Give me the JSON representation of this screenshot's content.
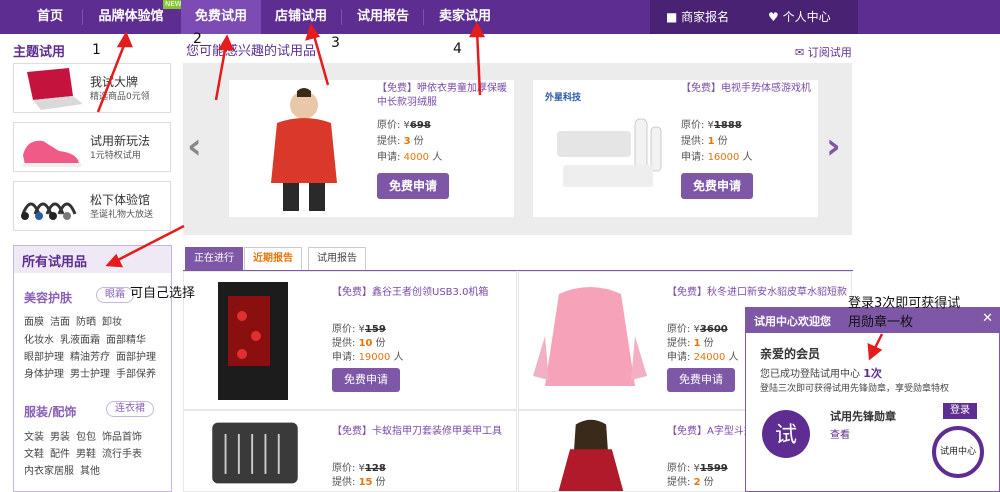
{
  "nav": {
    "items": [
      "首页",
      "品牌体验馆",
      "免费试用",
      "店铺试用",
      "试用报告",
      "卖家试用"
    ],
    "new_badge": "NEW",
    "merchant": "商家报名",
    "personal": "个人中心"
  },
  "sidebar": {
    "theme_title": "主题试用",
    "promos": [
      {
        "line1": "我试大牌",
        "line2": "精选商品0元领"
      },
      {
        "line1": "试用新玩法",
        "line2": "1元特权试用"
      },
      {
        "line1": "松下体验馆",
        "line2": "圣诞礼物大放送"
      }
    ],
    "all_title": "所有试用品",
    "groups": [
      {
        "title": "美容护肤",
        "tag": "眼霜",
        "rows": [
          [
            "面膜",
            "洁面",
            "防晒",
            "卸妆"
          ],
          [
            "化妆水",
            "乳液面霜",
            "面部精华"
          ],
          [
            "眼部护理",
            "精油芳疗",
            "面部护理"
          ],
          [
            "身体护理",
            "男士护理",
            "手部保养"
          ]
        ]
      },
      {
        "title": "服装/配饰",
        "tag": "连衣裙",
        "rows": [
          [
            "文装",
            "男装",
            "包包",
            "饰品首饰"
          ],
          [
            "文鞋",
            "配件",
            "男鞋",
            "流行手表"
          ],
          [
            "内衣家居服",
            "其他"
          ]
        ]
      }
    ]
  },
  "featured": {
    "title": "您可能感兴趣的试用品",
    "subscribe": "订阅试用",
    "price_label": "原价: ¥",
    "supply_label": "提供: ",
    "apply_label": "申请: ",
    "unit_fen": " 份",
    "unit_ren": " 人",
    "button": "免费申请",
    "cards": [
      {
        "tag": "【免费】",
        "name": "咿依衣男童加厚保暖中长款羽绒服",
        "price": "698",
        "supply": "3",
        "apply": "4000"
      },
      {
        "tag": "【免费】",
        "name": "电视手势体感游戏机",
        "price": "1888",
        "supply": "1",
        "apply": "16000",
        "brand": "外星科技"
      }
    ]
  },
  "tabs": [
    "正在进行",
    "近期报告",
    "试用报告"
  ],
  "products": [
    {
      "tag": "【免费】",
      "name": "鑫谷王者创领USB3.0机箱",
      "price": "159",
      "supply": "10",
      "apply": "19000"
    },
    {
      "tag": "【免费】",
      "name": "秋冬进口新安水貂皮草水貂短款",
      "price": "3600",
      "supply": "1",
      "apply": "24000"
    },
    {
      "tag": "【免费】",
      "name": "卡蚁指甲刀套装修甲美甲工具",
      "price": "128",
      "supply": "15",
      "apply": ""
    },
    {
      "tag": "【免费】",
      "name": "A字型斗篷",
      "price": "1599",
      "supply": "2",
      "apply": ""
    }
  ],
  "popup": {
    "title": "试用中心欢迎您",
    "greeting": "亲爱的会员",
    "login_prefix": "您已成功登陆试用中心 ",
    "login_count": "1次",
    "desc": "登陆三次即可获得试用先锋勋章，享受勋章特权",
    "medal": "试用先锋勋章",
    "login_button": "登录",
    "center": "试用中心",
    "view": "查看"
  },
  "annotations": {
    "n1": "1",
    "n2": "2",
    "n3": "3",
    "n4": "4",
    "choose": "可自己选择",
    "medal_note_1": "登录3次即可获得试",
    "medal_note_2": "用勋章一枚"
  },
  "colors": {
    "primary": "#5e2d91",
    "accent": "#7e57a7",
    "orange": "#e8740c",
    "arrow": "#e41c1c"
  }
}
